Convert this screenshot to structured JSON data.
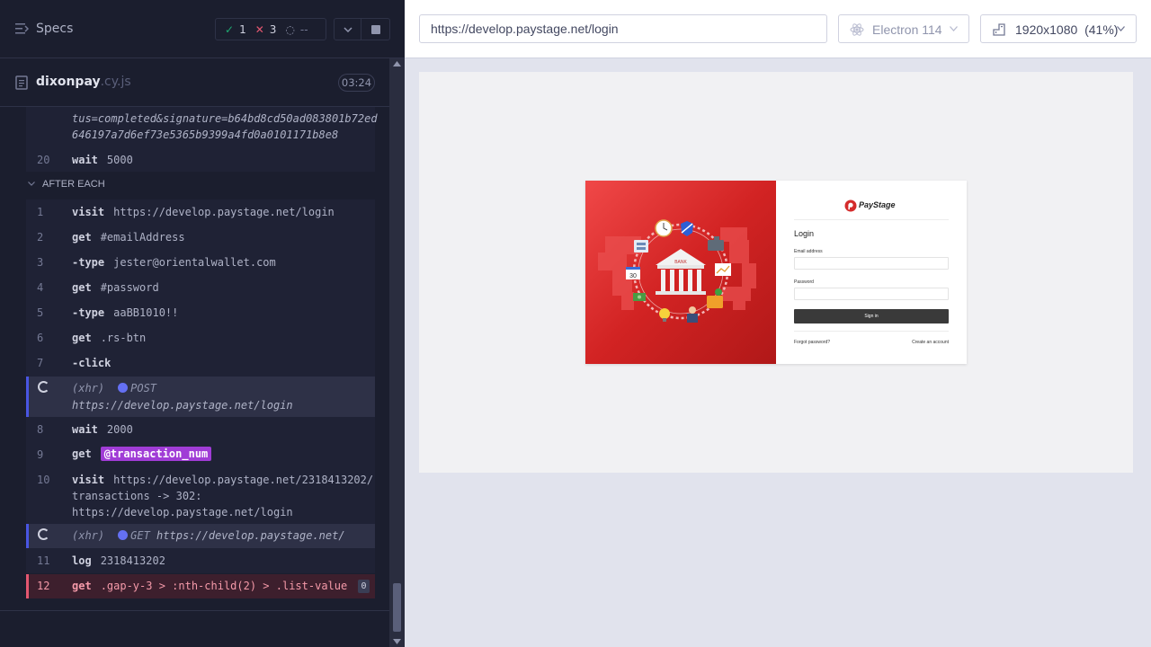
{
  "specs": {
    "label": "Specs"
  },
  "stats": {
    "passed": "1",
    "failed": "3",
    "pending": "--"
  },
  "file": {
    "name": "dixonpay",
    "ext": ".cy.js",
    "duration": "03:24"
  },
  "prev_commands": {
    "continuation_line1": "tus=completed&signature=b64bd8cd50ad083801b72ed",
    "continuation_line2": "646197a7d6ef73e5365b9399a4fd0a0101171b8e8",
    "wait_row": {
      "num": "20",
      "cmd": "wait",
      "msg": "5000"
    }
  },
  "after_each_label": "AFTER EACH",
  "commands": [
    {
      "num": "1",
      "cmd": "visit",
      "msg": "https://develop.paystage.net/login"
    },
    {
      "num": "2",
      "cmd": "get",
      "msg": "#emailAddress"
    },
    {
      "num": "3",
      "cmd": "-type",
      "msg": "jester@orientalwallet.com"
    },
    {
      "num": "4",
      "cmd": "get",
      "msg": "#password"
    },
    {
      "num": "5",
      "cmd": "-type",
      "msg": "aaBB1010!!"
    },
    {
      "num": "6",
      "cmd": "get",
      "msg": ".rs-btn"
    },
    {
      "num": "7",
      "cmd": "-click",
      "msg": ""
    }
  ],
  "xhr1": {
    "prefix": "(xhr)",
    "method": "POST",
    "url": "https://develop.paystage.net/login"
  },
  "cmd8": {
    "num": "8",
    "cmd": "wait",
    "msg": "2000"
  },
  "cmd9": {
    "num": "9",
    "cmd": "get",
    "alias": "@transaction_num"
  },
  "cmd10": {
    "num": "10",
    "cmd": "visit",
    "line1": "https://develop.paystage.net/2318413202/",
    "line2": "transactions -> 302:",
    "line3": "https://develop.paystage.net/login"
  },
  "xhr2": {
    "prefix": "(xhr)",
    "method": "GET",
    "url": "https://develop.paystage.net/"
  },
  "cmd11": {
    "num": "11",
    "cmd": "log",
    "msg": "2318413202"
  },
  "cmd12": {
    "num": "12",
    "cmd": "get",
    "msg": ".gap-y-3 > :nth-child(2) > .list-value",
    "count": "0"
  },
  "browser": {
    "url": "https://develop.paystage.net/login",
    "name": "Electron 114",
    "viewport": "1920x1080",
    "scale": "(41%)"
  },
  "app": {
    "brand": "PayStage",
    "login_title": "Login",
    "email_label": "Email address",
    "password_label": "Password",
    "signin_label": "Sign in",
    "forgot_label": "Forgot password?",
    "create_label": "Create an account",
    "bank_label": "BANK",
    "calendar_label": "30"
  },
  "colors": {
    "pass": "#1fa971",
    "fail": "#e45770",
    "xhr_dot": "#6470f3",
    "alias_bg": "#a03cd6",
    "hero_red": "#d22323"
  }
}
